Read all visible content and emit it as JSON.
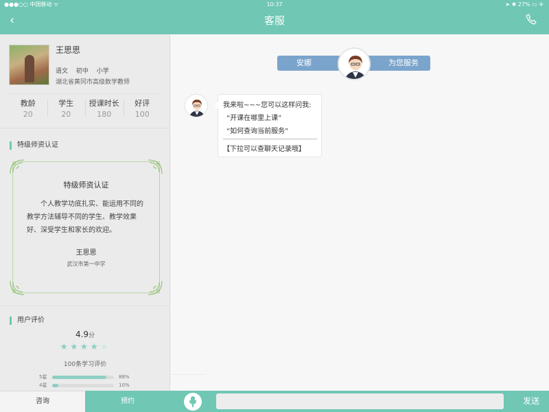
{
  "status_bar": {
    "carrier": "●●●○○ 中国移动 ᯤ",
    "time": "10:37",
    "battery": "27%"
  },
  "header": {
    "title": "客服"
  },
  "teacher": {
    "name": "王思思",
    "tags": [
      "语文",
      "初中",
      "小学"
    ],
    "school": "湖北省黄冈市高级数学教师",
    "stats": [
      {
        "label": "教龄",
        "value": "20"
      },
      {
        "label": "学生",
        "value": "20"
      },
      {
        "label": "授课时长",
        "value": "180"
      },
      {
        "label": "好评",
        "value": "100"
      }
    ]
  },
  "certification": {
    "section_title": "特级师资认证",
    "card_title": "特级师资认证",
    "body": "个人教学功底扎实、能运用不同的教学方法辅导不同的学生、教学效果好、深受学生和家长的欢迎。",
    "signature": "王思思",
    "signature_school": "武汉市第一中学"
  },
  "reviews": {
    "section_title": "用户评价",
    "score": "4.9",
    "score_unit": "分",
    "rating": 4.5,
    "count_text": "100条学习评价",
    "distribution": [
      {
        "label": "5星",
        "percent": "88%",
        "fraction": 0.88
      },
      {
        "label": "4星",
        "percent": "10%",
        "fraction": 0.1
      }
    ]
  },
  "chat": {
    "agent_name": "安娜",
    "service_label": "为您服务",
    "message": {
      "line1": "我来啦~~~您可以这样问我:",
      "line2": "“开课在哪里上课”",
      "line3": "“如何查询当前服务”",
      "footer": "【下拉可以查聊天记录哦】"
    }
  },
  "bottom": {
    "consult_label": "咨询",
    "book_label": "预约",
    "input_placeholder": "",
    "send_label": "发送"
  },
  "colors": {
    "accent": "#6fc7b4",
    "pill": "#7ba4cc",
    "star": "#8fcfc3"
  }
}
